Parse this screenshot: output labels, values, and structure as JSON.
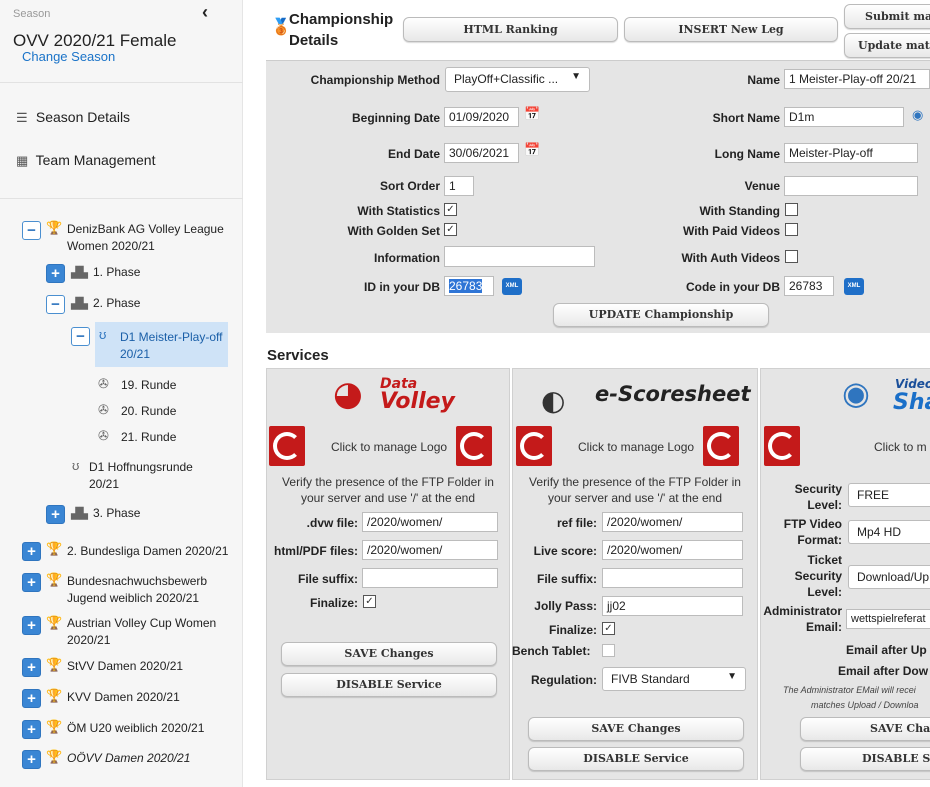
{
  "sidebar": {
    "season_label": "Season",
    "season_name": "OVV 2020/21 Female",
    "change_season": "Change Season",
    "menu": [
      {
        "label": "Season Details",
        "icon": "list-icon"
      },
      {
        "label": "Team Management",
        "icon": "grid-icon"
      }
    ],
    "tree": {
      "league1_line1": "DenizBank AG Volley League",
      "league1_line2": "Women 2020/21",
      "phase1": "1. Phase",
      "phase2": "2. Phase",
      "d1_line1": "D1 Meister-Play-off",
      "d1_line2": "20/21",
      "round19": "19. Runde",
      "round20": "20. Runde",
      "round21": "21. Runde",
      "hoff_line1": "D1 Hoffnungsrunde",
      "hoff_line2": "20/21",
      "phase3": "3. Phase",
      "league2": "2. Bundesliga Damen 2020/21",
      "league3_line1": "Bundesnachwuchsbewerb",
      "league3_line2": "Jugend weiblich 2020/21",
      "league4_line1": "Austrian Volley Cup Women",
      "league4_line2": "2020/21",
      "league5": "StVV Damen 2020/21",
      "league6": "KVV Damen 2020/21",
      "league7": "ÖM U20 weiblich 2020/21",
      "league8": "OÖVV Damen 2020/21"
    }
  },
  "header": {
    "title_line1": "Championship",
    "title_line2": "Details",
    "btn_html_ranking": "HTML Ranking",
    "btn_insert_leg": "INSERT New Leg",
    "btn_submit": "Submit ma",
    "btn_update": "Update mat"
  },
  "form": {
    "method_label": "Championship Method",
    "method_value": "PlayOff+Classific ...",
    "beginning_label": "Beginning Date",
    "beginning_value": "01/09/2020",
    "end_label": "End Date",
    "end_value": "30/06/2021",
    "sort_label": "Sort Order",
    "sort_value": "1",
    "stats_label": "With Statistics",
    "golden_label": "With Golden Set",
    "info_label": "Information",
    "id_label": "ID in your DB",
    "id_value": "26783",
    "name_label": "Name",
    "name_value": "1 Meister-Play-off 20/21",
    "short_label": "Short Name",
    "short_value": "D1m",
    "long_label": "Long Name",
    "long_value": "Meister-Play-off",
    "venue_label": "Venue",
    "venue_value": "",
    "standing_label": "With Standing",
    "paid_label": "With Paid Videos",
    "auth_label": "With Auth Videos",
    "code_label": "Code in your DB",
    "code_value": "26783",
    "xml_badge": "XML",
    "update_btn": "UPDATE Championship"
  },
  "services": {
    "title": "Services",
    "datavolley": {
      "logo_line1": "Data",
      "logo_line2": "Volley",
      "manage": "Click to manage Logo",
      "verify_line1": "Verify the presence of the FTP Folder in",
      "verify_line2": "your server and use '/' at the end",
      "dvw_label": ".dvw file:",
      "dvw_value": "/2020/women/",
      "html_label": "html/PDF files:",
      "html_value": "/2020/women/",
      "suffix_label": "File suffix:",
      "suffix_value": "",
      "finalize_label": "Finalize:",
      "save_btn": "SAVE Changes",
      "disable_btn": "DISABLE Service"
    },
    "escoresheet": {
      "logo": "e-Scoresheet",
      "manage": "Click to manage Logo",
      "verify_line1": "Verify the presence of the FTP Folder in",
      "verify_line2": "your server and use '/' at the end",
      "ref_label": "ref file:",
      "ref_value": "/2020/women/",
      "live_label": "Live score:",
      "live_value": "/2020/women/",
      "suffix_label": "File suffix:",
      "suffix_value": "",
      "jolly_label": "Jolly Pass:",
      "jolly_value": "jj02",
      "finalize_label": "Finalize:",
      "bench_label": "Bench Tablet:",
      "regulation_label": "Regulation:",
      "regulation_value": "FIVB Standard",
      "save_btn": "SAVE Changes",
      "disable_btn": "DISABLE Service"
    },
    "videoshare": {
      "logo_line1": "Video",
      "logo_line2": "Sha",
      "manage": "Click to m",
      "security_label_1": "Security",
      "security_label_2": "Level:",
      "security_value": "FREE",
      "ftp_label_1": "FTP Video",
      "ftp_label_2": "Format:",
      "ftp_value": "Mp4 HD",
      "ticket_label_1": "Ticket",
      "ticket_label_2": "Security",
      "ticket_label_3": "Level:",
      "ticket_value": "Download/Up",
      "admin_label_1": "Administrator",
      "admin_label_2": "Email:",
      "admin_value": "wettspielreferat",
      "email_upload": "Email after Up",
      "email_download": "Email after Dow",
      "note_line1": "The Administrator EMail will recei",
      "note_line2": "matches Upload / Downloa",
      "save_btn": "SAVE Chan",
      "disable_btn": "DISABLE Se"
    }
  },
  "colors": {
    "accent": "#1f6fc8",
    "selected": "#cfe3f7",
    "panel": "#e5e5e5",
    "brand_red": "#c41a1a"
  }
}
